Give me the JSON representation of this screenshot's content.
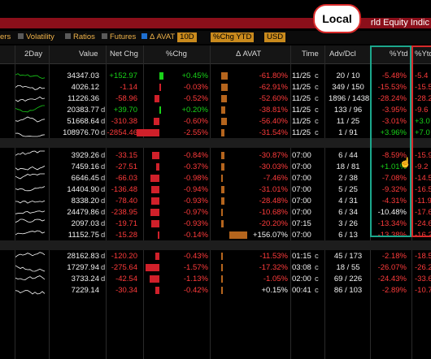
{
  "window": {
    "title": "rld Equity Indic"
  },
  "toolbar": {
    "items": [
      {
        "label": "ers",
        "checked": null
      },
      {
        "label": "Volatility",
        "checked": false
      },
      {
        "label": "Ratios",
        "checked": false
      },
      {
        "label": "Futures",
        "checked": false
      },
      {
        "label": "Δ AVAT",
        "checked": true,
        "select": "10D"
      },
      {
        "label": "",
        "checked": null,
        "select": "%Chg YTD"
      },
      {
        "label": "",
        "checked": null,
        "select": "USD"
      }
    ]
  },
  "header": {
    "cols": [
      "2Day",
      "Value",
      "Net Chg",
      "%Chg",
      "Δ AVAT",
      "Time",
      "Adv/Dcl",
      "%Ytd",
      "%Ytd"
    ]
  },
  "annotation": {
    "callout": "Local"
  },
  "colors": {
    "positive": "#19d219",
    "negative": "#ff3b3b",
    "avat_bar": "#b5651d",
    "accent": "#c98a1d",
    "local_box": "#1ca78c",
    "usd_box": "#d82a2a"
  },
  "groups": [
    {
      "rows": [
        {
          "value": "34347.03",
          "vs": "",
          "net": "+152.97",
          "pct": "+0.45%",
          "pctv": 0.45,
          "avat": "-61.80%",
          "avatv": -61.8,
          "time": "11/25",
          "tsuf": "c",
          "advdcl": "20 / 10",
          "ytd": "-5.48%",
          "usd": "-5.4"
        },
        {
          "value": "4026.12",
          "vs": "",
          "net": "-1.14",
          "pct": "-0.03%",
          "pctv": -0.03,
          "avat": "-62.91%",
          "avatv": -62.91,
          "time": "11/25",
          "tsuf": "c",
          "advdcl": "349 / 150",
          "ytd": "-15.53%",
          "usd": "-15.5"
        },
        {
          "value": "11226.36",
          "vs": "",
          "net": "-58.96",
          "pct": "-0.52%",
          "pctv": -0.52,
          "avat": "-52.60%",
          "avatv": -52.6,
          "time": "11/25",
          "tsuf": "c",
          "advdcl": "1896 / 1438",
          "ytd": "-28.24%",
          "usd": "-28.2"
        },
        {
          "value": "20383.77",
          "vs": "d",
          "net": "+39.70",
          "pct": "+0.20%",
          "pctv": 0.2,
          "avat": "-38.81%",
          "avatv": -38.81,
          "time": "11/25",
          "tsuf": "c",
          "advdcl": "133 / 96",
          "ytd": "-3.95%",
          "usd": "-9.6"
        },
        {
          "value": "51668.64",
          "vs": "d",
          "net": "-310.38",
          "pct": "-0.60%",
          "pctv": -0.6,
          "avat": "-56.40%",
          "avatv": -56.4,
          "time": "11/25",
          "tsuf": "c",
          "advdcl": "11 / 25",
          "ytd": "-3.01%",
          "usd": "+3.0"
        },
        {
          "value": "108976.70",
          "vs": "d",
          "net": "-2854.46",
          "pct": "-2.55%",
          "pctv": -2.55,
          "avat": "-31.54%",
          "avatv": -31.54,
          "time": "11/25",
          "tsuf": "c",
          "advdcl": "1 / 91",
          "ytd": "+3.96%",
          "usd": "+7.0"
        }
      ]
    },
    {
      "rows": [
        {
          "value": "3929.26",
          "vs": "d",
          "net": "-33.15",
          "pct": "-0.84%",
          "pctv": -0.84,
          "avat": "-30.87%",
          "avatv": -30.87,
          "time": "07:00",
          "tsuf": "",
          "advdcl": "6 / 44",
          "ytd": "-8.59%",
          "usd": "-15.9"
        },
        {
          "value": "7459.16",
          "vs": "d",
          "net": "-27.51",
          "pct": "-0.37%",
          "pctv": -0.37,
          "avat": "-30.03%",
          "avatv": -30.03,
          "time": "07:00",
          "tsuf": "",
          "advdcl": "18 / 81",
          "ytd": "+1.01%",
          "usd": "-9.2"
        },
        {
          "value": "6646.45",
          "vs": "d",
          "net": "-66.03",
          "pct": "-0.98%",
          "pctv": -0.98,
          "avat": "-7.46%",
          "avatv": -7.46,
          "time": "07:00",
          "tsuf": "",
          "advdcl": "2 / 38",
          "ytd": "-7.08%",
          "usd": "-14.5"
        },
        {
          "value": "14404.90",
          "vs": "d",
          "net": "-136.48",
          "pct": "-0.94%",
          "pctv": -0.94,
          "avat": "-31.01%",
          "avatv": -31.01,
          "time": "07:00",
          "tsuf": "",
          "advdcl": "5 / 25",
          "ytd": "-9.32%",
          "usd": "-16.5"
        },
        {
          "value": "8338.20",
          "vs": "d",
          "net": "-78.40",
          "pct": "-0.93%",
          "pctv": -0.93,
          "avat": "-28.48%",
          "avatv": -28.48,
          "time": "07:00",
          "tsuf": "",
          "advdcl": "4 / 31",
          "ytd": "-4.31%",
          "usd": "-11.9"
        },
        {
          "value": "24479.86",
          "vs": "d",
          "net": "-238.95",
          "pct": "-0.97%",
          "pctv": -0.97,
          "avat": "-10.68%",
          "avatv": -10.68,
          "time": "07:00",
          "tsuf": "",
          "advdcl": "6 / 34",
          "ytd": "-10.48%",
          "usd": "-17.6"
        },
        {
          "value": "2097.03",
          "vs": "d",
          "net": "-19.71",
          "pct": "-0.93%",
          "pctv": -0.93,
          "avat": "-20.20%",
          "avatv": -20.2,
          "time": "07:15",
          "tsuf": "",
          "advdcl": "3 / 26",
          "ytd": "-13.34%",
          "usd": "-24.6"
        },
        {
          "value": "11152.75",
          "vs": "d",
          "net": "-15.28",
          "pct": "-0.14%",
          "pctv": -0.14,
          "avat": "+156.07%",
          "avatv": 156.07,
          "time": "07:00",
          "tsuf": "",
          "advdcl": "6 / 13",
          "ytd": "-13.38%",
          "usd": "-16.2"
        }
      ]
    },
    {
      "rows": [
        {
          "value": "28162.83",
          "vs": "d",
          "net": "-120.20",
          "pct": "-0.43%",
          "pctv": -0.43,
          "avat": "-11.53%",
          "avatv": -11.53,
          "time": "01:15",
          "tsuf": "c",
          "advdcl": "45 / 173",
          "ytd": "-2.18%",
          "usd": "-18.5"
        },
        {
          "value": "17297.94",
          "vs": "d",
          "net": "-275.64",
          "pct": "-1.57%",
          "pctv": -1.57,
          "avat": "-17.32%",
          "avatv": -17.32,
          "time": "03:08",
          "tsuf": "c",
          "advdcl": "18 / 55",
          "ytd": "-26.07%",
          "usd": "-26.2"
        },
        {
          "value": "3733.24",
          "vs": "d",
          "net": "-42.54",
          "pct": "-1.13%",
          "pctv": -1.13,
          "avat": "-1.05%",
          "avatv": -1.05,
          "time": "02:00",
          "tsuf": "c",
          "advdcl": "69 / 226",
          "ytd": "-24.43%",
          "usd": "-33.6"
        },
        {
          "value": "7229.14",
          "vs": "",
          "net": "-30.34",
          "pct": "-0.42%",
          "pctv": -0.42,
          "avat": "+0.15%",
          "avatv": 0.15,
          "time": "00:41",
          "tsuf": "c",
          "advdcl": "86 / 103",
          "ytd": "-2.89%",
          "usd": "-10.7"
        }
      ]
    }
  ]
}
